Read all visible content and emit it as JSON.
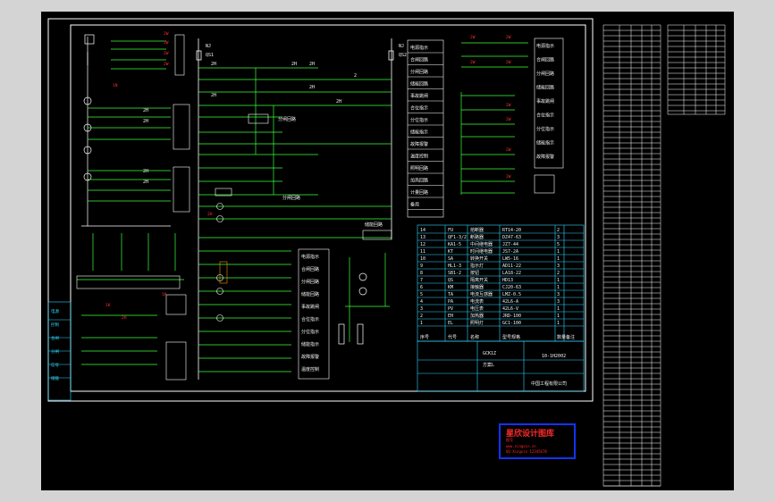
{
  "drawing": {
    "title_block": {
      "name": "GCK1Z",
      "sub": "方案L",
      "code": "10-1H2002",
      "company": "中国工程有限公司"
    }
  },
  "stamp": {
    "title": "星欣设计图库",
    "line1": "图号",
    "line2": "www.xingxin.cn",
    "line3": "QQ:Xingxin 12345678"
  },
  "left_labels": [
    "电源",
    "控制",
    "合闸",
    "分闸",
    "信号",
    "储能"
  ],
  "right_desc": [
    "电源指示",
    "合闸回路",
    "分闸回路",
    "储能回路",
    "事故跳闸",
    "合位指示",
    "分位指示",
    "储能指示",
    "故障报警",
    "温度控制",
    "照明回路",
    "加热回路",
    "计量回路",
    "备用"
  ],
  "bom_rows": [
    [
      "14",
      "FU",
      "熔断器",
      "RT14-20",
      "2",
      ""
    ],
    [
      "13",
      "QF1-3/2",
      "断路器",
      "DZ47-63",
      "3",
      ""
    ],
    [
      "12",
      "KA1-5",
      "中间继电器",
      "JZ7-44",
      "5",
      ""
    ],
    [
      "11",
      "KT",
      "时间继电器",
      "JS7-2A",
      "1",
      ""
    ],
    [
      "10",
      "SA",
      "转换开关",
      "LW5-16",
      "1",
      ""
    ],
    [
      "9",
      "HL1-3",
      "指示灯",
      "AD11-22",
      "3",
      ""
    ],
    [
      "8",
      "SB1-2",
      "按钮",
      "LA18-22",
      "2",
      ""
    ],
    [
      "7",
      "QS",
      "隔离开关",
      "HD13",
      "1",
      ""
    ],
    [
      "6",
      "KM",
      "接触器",
      "CJ20-63",
      "1",
      ""
    ],
    [
      "5",
      "TA",
      "电流互感器",
      "LMZ-0.5",
      "3",
      ""
    ],
    [
      "4",
      "PA",
      "电流表",
      "42L6-A",
      "3",
      ""
    ],
    [
      "3",
      "PV",
      "电压表",
      "42L6-V",
      "1",
      ""
    ],
    [
      "2",
      "EH",
      "加热器",
      "JRD-100",
      "1",
      ""
    ],
    [
      "1",
      "EL",
      "照明灯",
      "GC1-100",
      "1",
      ""
    ]
  ],
  "bom_header": [
    "序号",
    "代号",
    "名称",
    "型号规格",
    "数量",
    "备注"
  ]
}
